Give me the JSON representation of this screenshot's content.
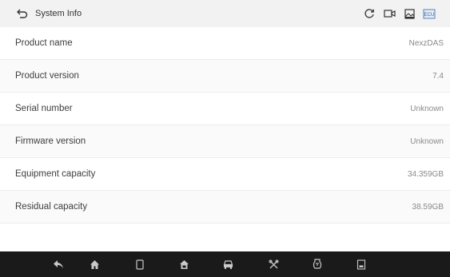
{
  "header": {
    "title": "System Info",
    "back_icon": "back-arrow-icon",
    "actions": [
      "refresh-icon",
      "video-record-icon",
      "gallery-icon",
      "ecu-icon"
    ],
    "ecu_label": "ECU"
  },
  "info_rows": [
    {
      "label": "Product name",
      "value": "NexzDAS"
    },
    {
      "label": "Product version",
      "value": "7.4"
    },
    {
      "label": "Serial number",
      "value": "Unknown"
    },
    {
      "label": "Firmware version",
      "value": "Unknown"
    },
    {
      "label": "Equipment capacity",
      "value": "34.359GB"
    },
    {
      "label": "Residual capacity",
      "value": "38.59GB"
    }
  ],
  "navbar": {
    "items": [
      "back-icon",
      "home-icon",
      "recent-apps-icon",
      "vci-home-icon",
      "vehicle-icon",
      "tools-icon",
      "diagnose-icon",
      "screenshot-icon"
    ]
  },
  "colors": {
    "header_bg": "#f2f2f2",
    "navbar_bg": "#1a1a1a",
    "nav_icon": "#c9c9c9"
  }
}
